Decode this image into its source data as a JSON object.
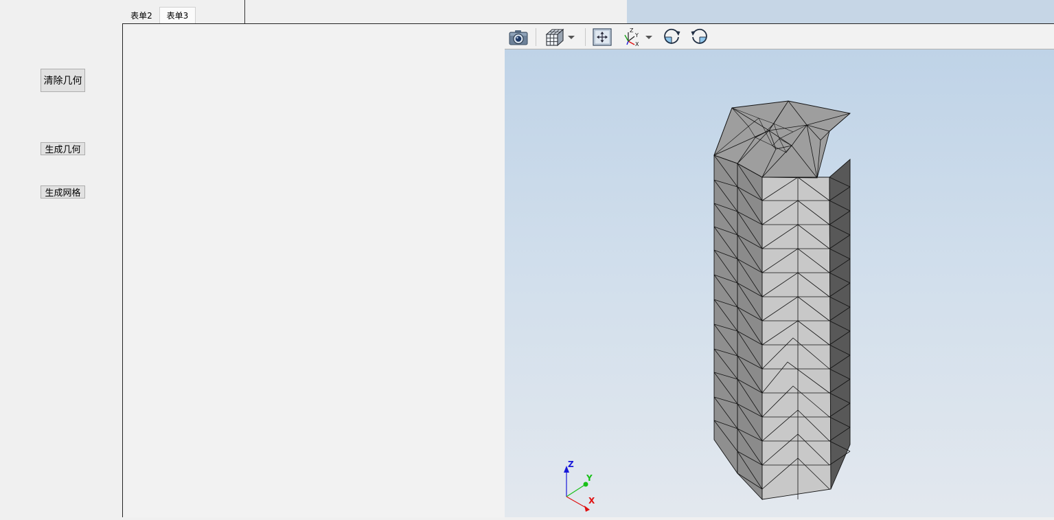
{
  "tabs": [
    {
      "label": "表单2"
    },
    {
      "label": "表单3"
    }
  ],
  "sidebar": {
    "clear_geometry": "清除几何",
    "generate_geometry": "生成几何",
    "generate_mesh": "生成网格"
  },
  "toolbar": {
    "icons": [
      "camera-icon",
      "cube-view-icon",
      "dropdown-arrow-icon",
      "fit-all-icon",
      "axis-icon",
      "dropdown-arrow-icon",
      "rotate-cw-icon",
      "rotate-ccw-icon"
    ],
    "axis_icon_labels": {
      "z": "Z",
      "y": "Y",
      "x": "X"
    }
  },
  "triad": {
    "x": "X",
    "y": "Y",
    "z": "Z"
  },
  "colors": {
    "viewport_top": "#bfd3e7",
    "viewport_bottom": "#e3e8ee",
    "mesh_top": "#9e9e9e",
    "mesh_left": "#8c8c8c",
    "mesh_front": "#c8c8c8",
    "mesh_right": "#5a5a5a",
    "axis_x": "#e01010",
    "axis_y": "#18c018",
    "axis_z": "#1818d8"
  }
}
